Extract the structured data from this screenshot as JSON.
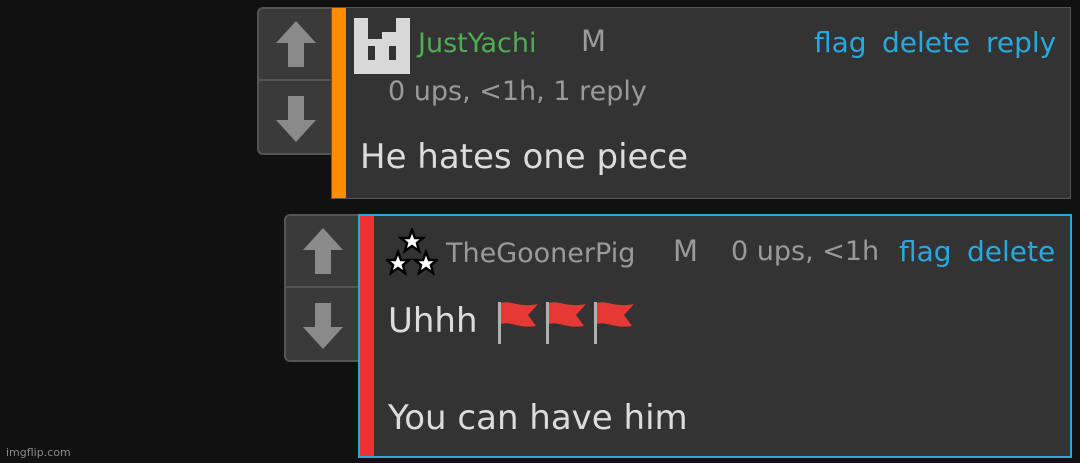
{
  "colors": {
    "background": "#111111",
    "panel": "#333333",
    "username_green": "#4caf50",
    "link_blue": "#29a8e0",
    "stripe_orange": "#ff8c00",
    "stripe_red": "#f03030",
    "focused_border": "#2aa7dd",
    "muted_text": "#9a9a9a",
    "body_text": "#dcdcdc"
  },
  "comments": [
    {
      "avatar": "pixel-face-icon",
      "username": "JustYachi",
      "badge": "M",
      "meta": "0 ups, <1h, 1 reply",
      "actions": {
        "flag": "flag",
        "delete": "delete",
        "reply": "reply"
      },
      "body": "He hates one piece"
    },
    {
      "avatar": "three-stars-icon",
      "username": "TheGoonerPig",
      "badge": "M",
      "meta": "0 ups, <1h",
      "actions": {
        "flag": "flag",
        "delete": "delete"
      },
      "body_line1": "Uhhh",
      "body_emoji": "red-flag-icon x3",
      "body_line2": "You can have him"
    }
  ],
  "watermark": "imgflip.com"
}
